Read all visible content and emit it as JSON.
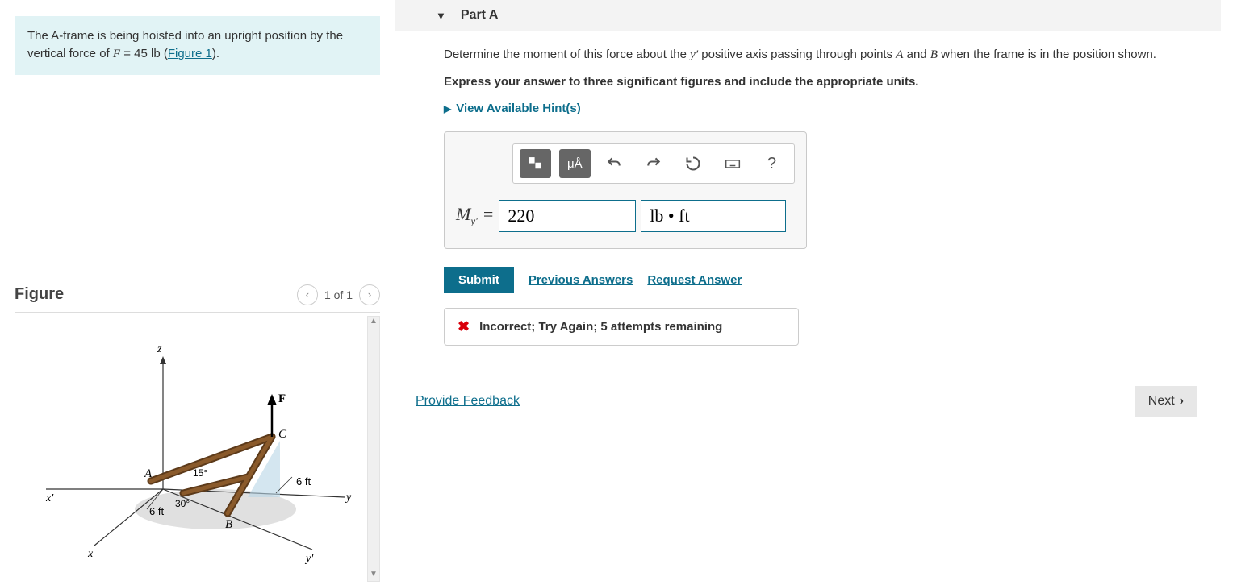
{
  "left": {
    "problem_before": "The A-frame is being hoisted into an upright position by the vertical force of ",
    "force_var": "F",
    "force_value": " = 45 lb",
    "problem_after_open": " (",
    "figure_link": "Figure 1",
    "problem_after_close": ").",
    "figure_title": "Figure",
    "figure_counter": "1 of 1",
    "diagram": {
      "z": "z",
      "x": "x",
      "xprime": "x'",
      "y": "y",
      "yprime": "y'",
      "A": "A",
      "B": "B",
      "C": "C",
      "F": "F",
      "angle1": "15°",
      "angle2": "30°",
      "dim1": "6 ft",
      "dim2": "6 ft"
    }
  },
  "right": {
    "part_label": "Part A",
    "question_p1": "Determine the moment of this force about the ",
    "question_yprime": "y′",
    "question_p2": " positive axis passing through points ",
    "question_A": "A",
    "question_p3": " and ",
    "question_B": "B",
    "question_p4": " when the frame is in the position shown.",
    "instruction": "Express your answer to three significant figures and include the appropriate units.",
    "hints_label": "View Available Hint(s)",
    "toolbar": {
      "mu": "μÅ",
      "help": "?"
    },
    "answer": {
      "label_main": "M",
      "label_sub": "y′",
      "equals": " = ",
      "value": "220",
      "unit": "lb • ft"
    },
    "submit": "Submit",
    "prev_answers": "Previous Answers",
    "request_answer": "Request Answer",
    "feedback": "Incorrect; Try Again; 5 attempts remaining",
    "provide_feedback": "Provide Feedback",
    "next": "Next"
  }
}
